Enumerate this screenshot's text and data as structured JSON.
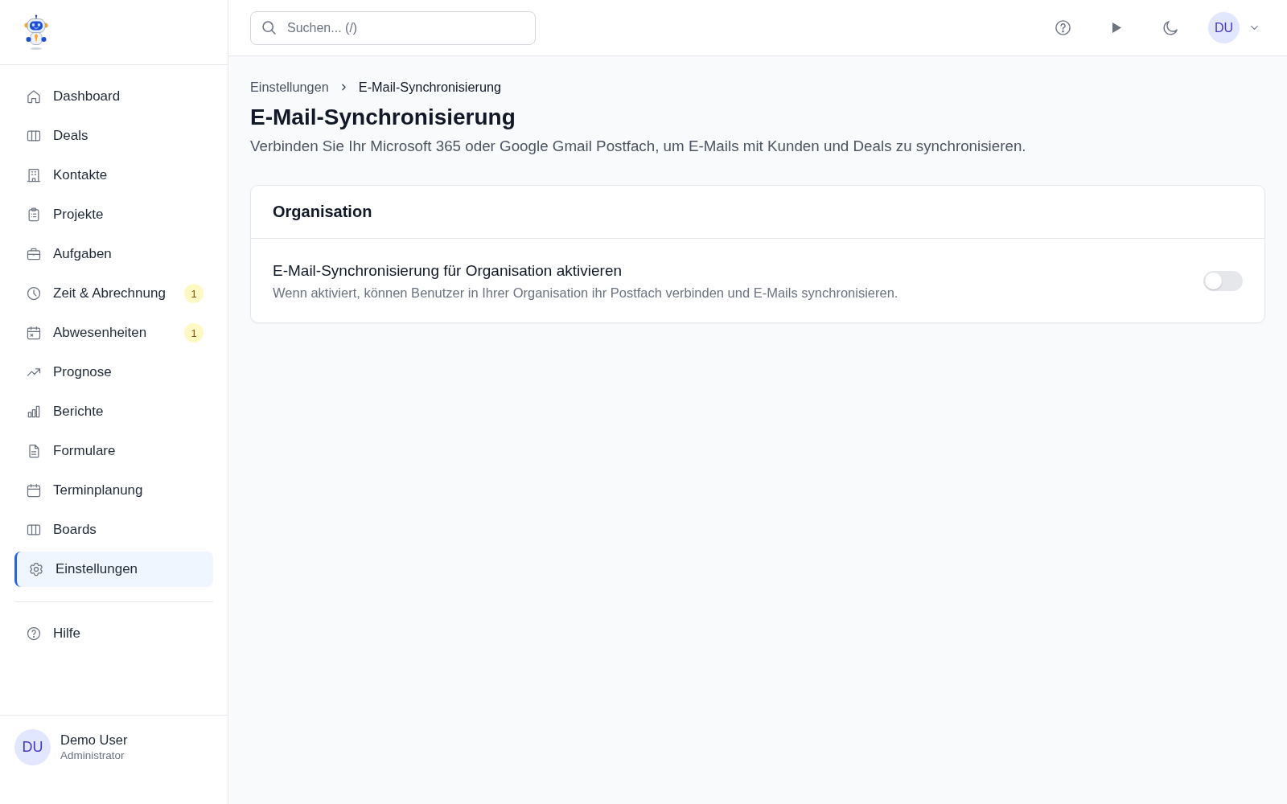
{
  "sidebar": {
    "items": [
      {
        "label": "Dashboard",
        "selected": false
      },
      {
        "label": "Deals",
        "selected": false
      },
      {
        "label": "Kontakte",
        "selected": false
      },
      {
        "label": "Projekte",
        "selected": false
      },
      {
        "label": "Aufgaben",
        "selected": false
      },
      {
        "label": "Zeit & Abrechnung",
        "badge": "1",
        "selected": false
      },
      {
        "label": "Abwesenheiten",
        "badge": "1",
        "selected": false
      },
      {
        "label": "Prognose",
        "selected": false
      },
      {
        "label": "Berichte",
        "selected": false
      },
      {
        "label": "Formulare",
        "selected": false
      },
      {
        "label": "Terminplanung",
        "selected": false
      },
      {
        "label": "Boards",
        "selected": false
      },
      {
        "label": "Einstellungen",
        "selected": true
      }
    ],
    "footer_items": [
      {
        "label": "Hilfe",
        "selected": false
      }
    ],
    "user": {
      "initials": "DU",
      "name": "Demo User",
      "role": "Administrator"
    }
  },
  "top_bar": {
    "search": {
      "placeholder": "Suchen... (/)"
    },
    "user": {
      "initials": "DU"
    }
  },
  "breadcrumb": [
    {
      "label": "Einstellungen"
    },
    {
      "label": "E-Mail-Synchronisierung"
    }
  ],
  "page": {
    "title": "E-Mail-Synchronisierung",
    "subtitle": "Verbinden Sie Ihr Microsoft 365 oder Google Gmail Postfach, um E-Mails mit Kunden und Deals zu synchronisieren."
  },
  "card": {
    "title": "Organisation",
    "settings": [
      {
        "label": "E-Mail-Synchronisierung für Organisation aktivieren",
        "description": "Wenn aktiviert, können Benutzer in Ihrer Organisation ihr Postfach verbinden und E-Mails synchronisieren.",
        "on": false
      }
    ]
  }
}
